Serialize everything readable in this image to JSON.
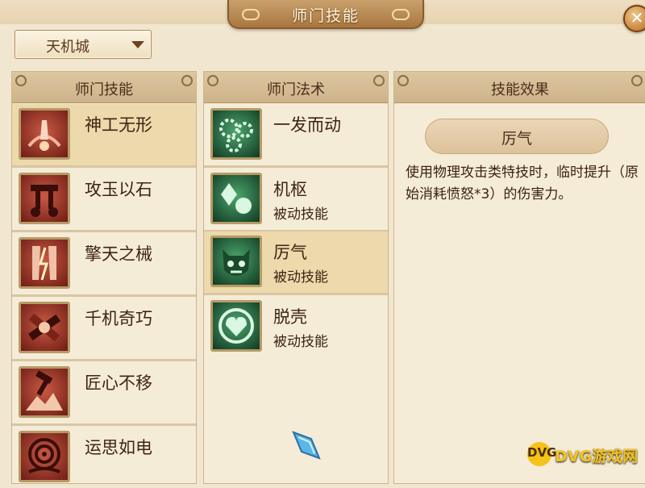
{
  "window": {
    "title": "师门技能",
    "close_icon": "close-icon"
  },
  "city_select": {
    "value": "天机城"
  },
  "skills_panel": {
    "header": "师门技能",
    "items": [
      {
        "name": "神工无形",
        "icon": "hand-vortex-icon",
        "selected": true
      },
      {
        "name": "攻玉以石",
        "icon": "stone-hammer-icon",
        "selected": false
      },
      {
        "name": "擎天之械",
        "icon": "lightning-pillar-icon",
        "selected": false
      },
      {
        "name": "千机奇巧",
        "icon": "crossed-gear-icon",
        "selected": false
      },
      {
        "name": "匠心不移",
        "icon": "mountain-hammer-icon",
        "selected": false
      },
      {
        "name": "运思如电",
        "icon": "spiral-eye-icon",
        "selected": false
      }
    ]
  },
  "spells_panel": {
    "header": "师门法术",
    "items": [
      {
        "name": "一发而动",
        "sub": "",
        "icon": "gears-icon",
        "selected": false
      },
      {
        "name": "机枢",
        "sub": "被动技能",
        "icon": "diamond-orb-icon",
        "selected": false
      },
      {
        "name": "厉气",
        "sub": "被动技能",
        "icon": "demon-face-icon",
        "selected": true
      },
      {
        "name": "脱壳",
        "sub": "被动技能",
        "icon": "heart-shell-icon",
        "selected": false
      }
    ]
  },
  "effect_panel": {
    "header": "技能效果",
    "skill_name": "厉气",
    "description": "使用物理攻击类特技时，临时提升（原始消耗愤怒*3）的伤害力。"
  },
  "watermark": {
    "logo": "DVG",
    "text": "DVG游戏网"
  },
  "colors": {
    "gold": "#f5c21b",
    "panel": "#f5ecd8",
    "accent_red": "#c95a45",
    "accent_green": "#4ea56e"
  }
}
